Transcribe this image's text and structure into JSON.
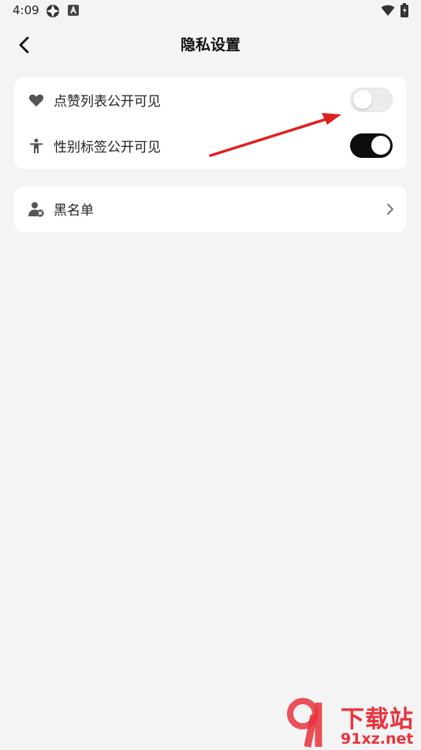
{
  "status_bar": {
    "time": "4:09",
    "icons": [
      "location-icon",
      "a-badge-icon",
      "wifi-icon",
      "battery-icon"
    ]
  },
  "header": {
    "title": "隐私设置",
    "back_icon": "back-arrow-icon"
  },
  "privacy_card": {
    "items": [
      {
        "icon": "heart-icon",
        "label": "点赞列表公开可见",
        "toggle_on": false
      },
      {
        "icon": "person-icon",
        "label": "性别标签公开可见",
        "toggle_on": true
      }
    ]
  },
  "blacklist_card": {
    "icon": "user-blocked-icon",
    "label": "黑名单",
    "chevron_icon": "chevron-right-icon"
  },
  "annotation": {
    "arrow_color": "#e0201f"
  },
  "watermark": {
    "site_name": "下载站",
    "domain": "91xz.net",
    "color": "#e8333c"
  },
  "colors": {
    "background": "#f4f4f4",
    "card": "#ffffff",
    "toggle_on": "#0d0d0d",
    "toggle_off": "#ececec"
  }
}
